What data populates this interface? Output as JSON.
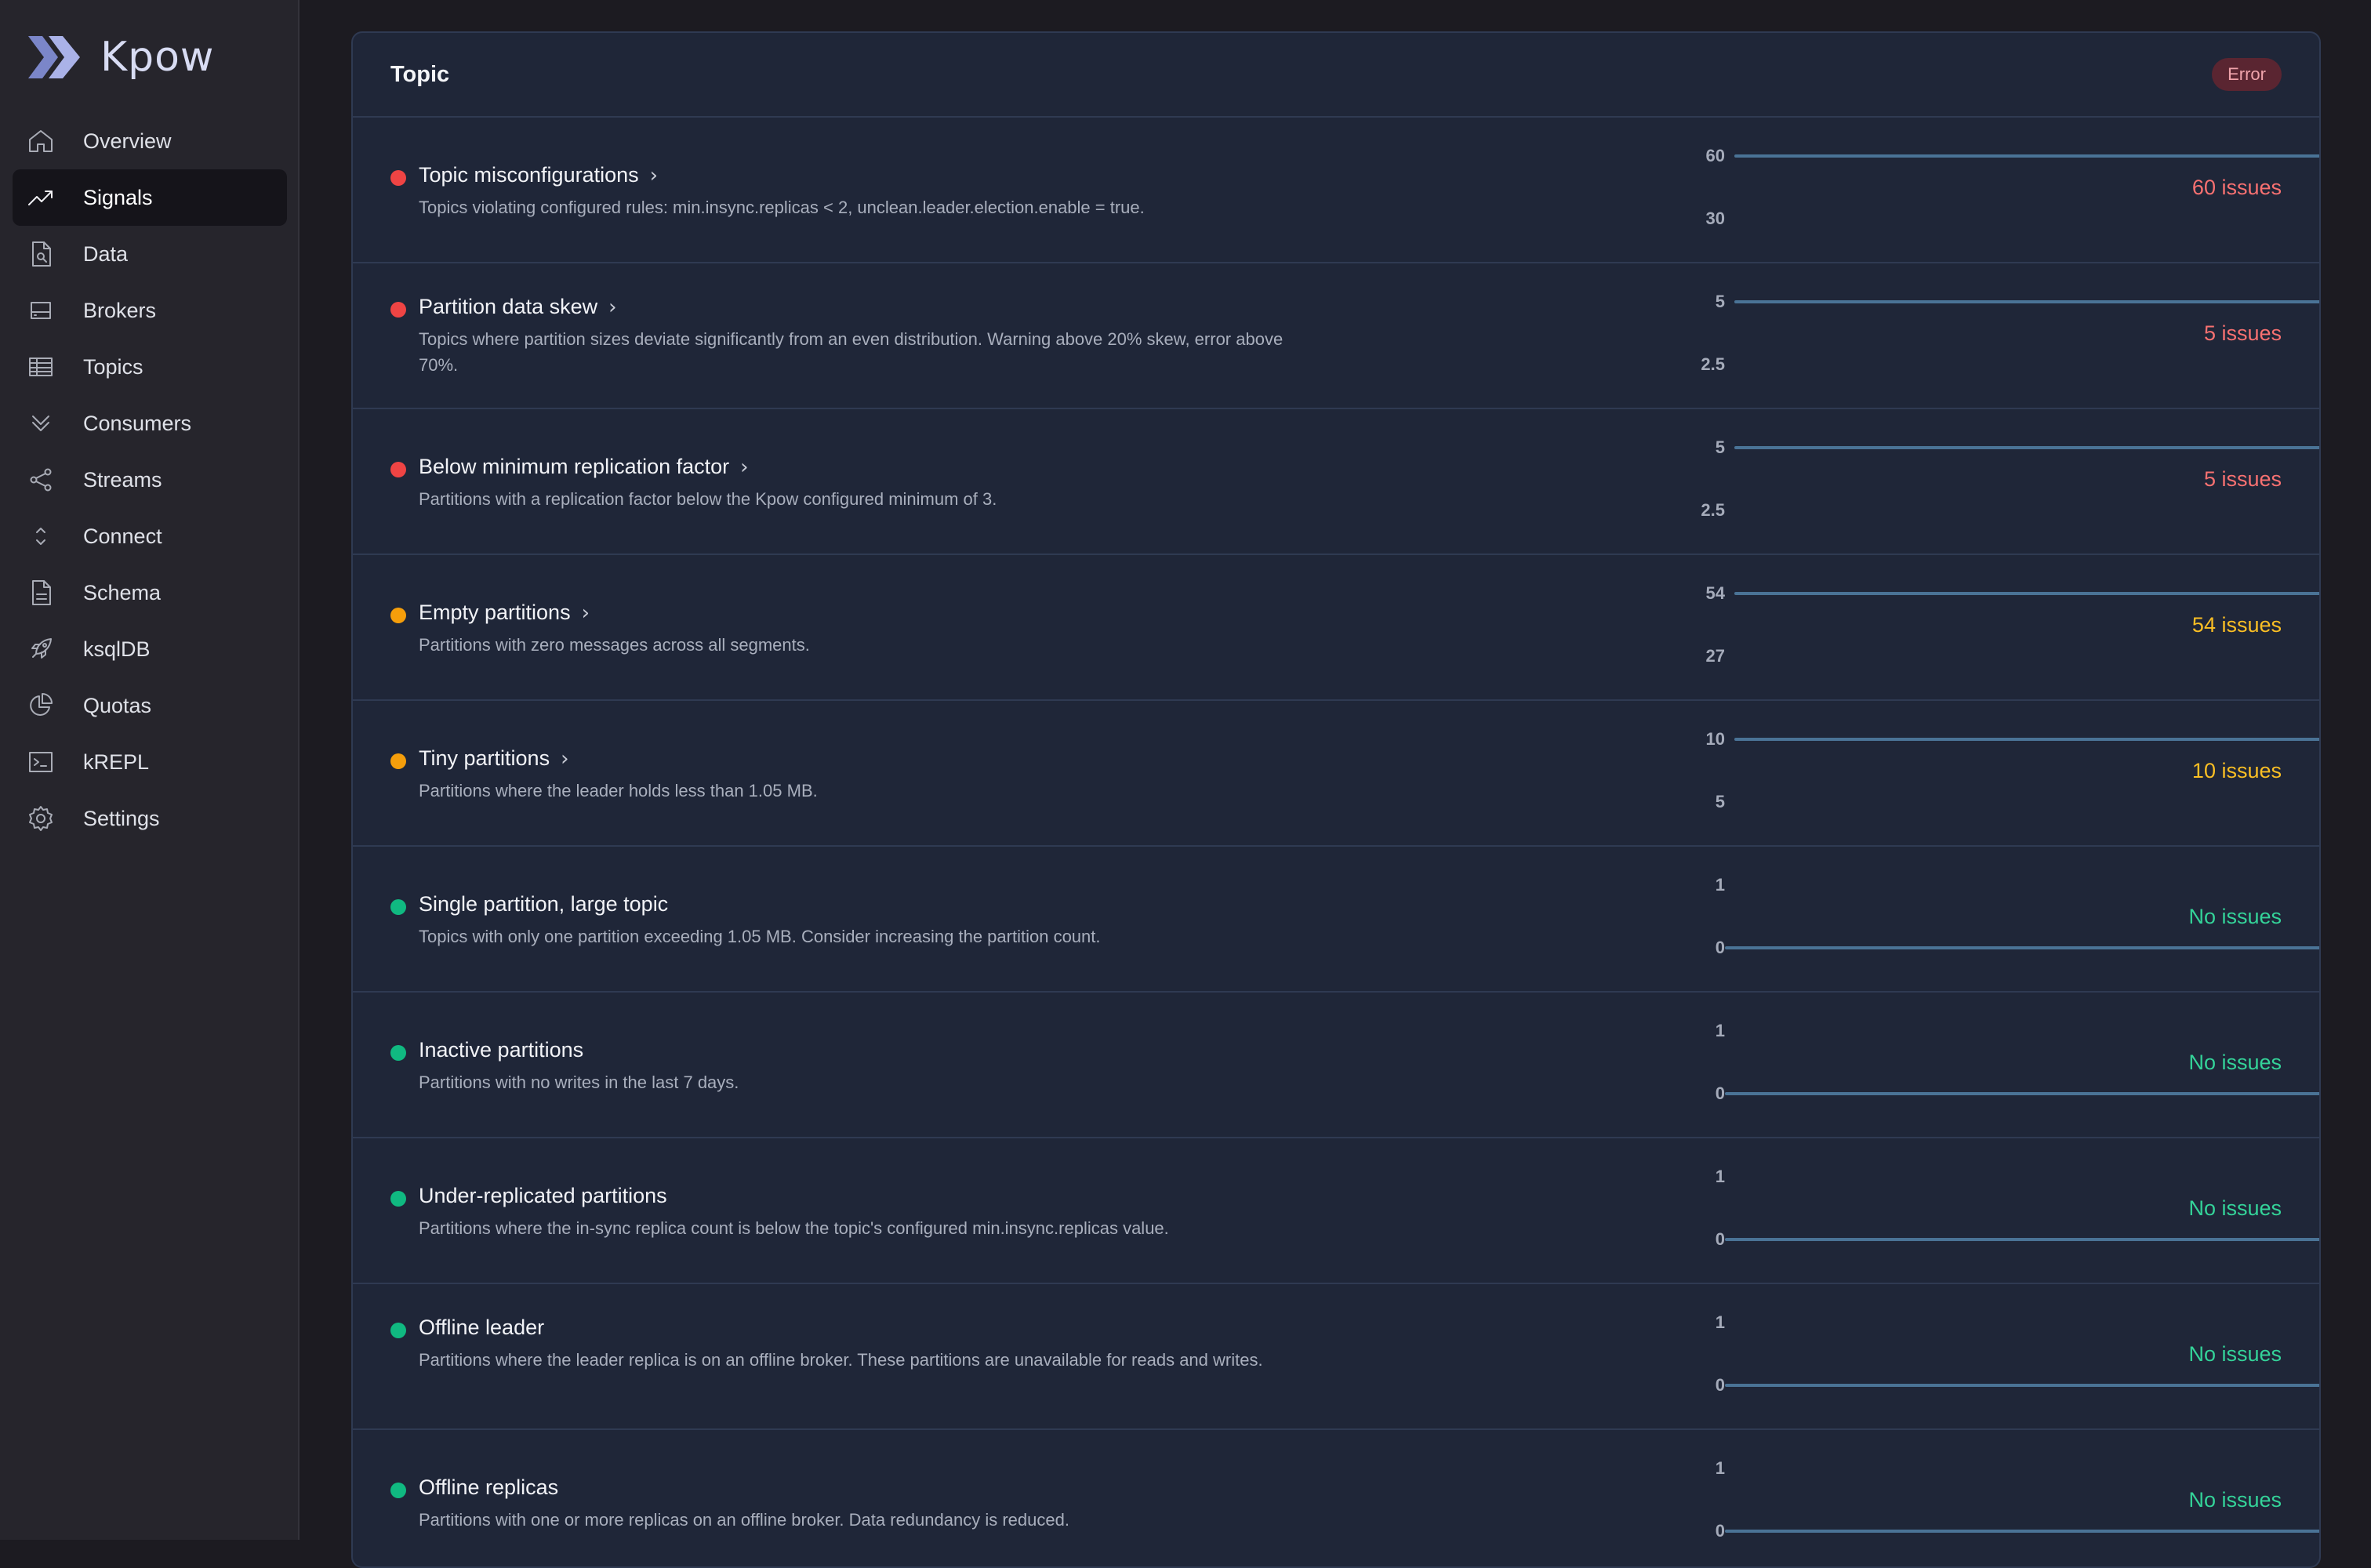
{
  "app": {
    "logo_text": "Kpow"
  },
  "sidebar": {
    "items": [
      {
        "label": "Overview",
        "icon": "home-icon",
        "active": false
      },
      {
        "label": "Signals",
        "icon": "trend-icon",
        "active": true
      },
      {
        "label": "Data",
        "icon": "file-search-icon",
        "active": false
      },
      {
        "label": "Brokers",
        "icon": "server-icon",
        "active": false
      },
      {
        "label": "Topics",
        "icon": "table-icon",
        "active": false
      },
      {
        "label": "Consumers",
        "icon": "double-chevron-down-icon",
        "active": false
      },
      {
        "label": "Streams",
        "icon": "share-icon",
        "active": false
      },
      {
        "label": "Connect",
        "icon": "chevrons-up-down-icon",
        "active": false
      },
      {
        "label": "Schema",
        "icon": "document-icon",
        "active": false
      },
      {
        "label": "ksqlDB",
        "icon": "rocket-icon",
        "active": false
      },
      {
        "label": "Quotas",
        "icon": "pie-chart-icon",
        "active": false
      },
      {
        "label": "kREPL",
        "icon": "terminal-icon",
        "active": false
      },
      {
        "label": "Settings",
        "icon": "gear-icon",
        "active": false
      }
    ]
  },
  "panel": {
    "title": "Topic",
    "badge": "Error",
    "colors": {
      "error": "#ef4444",
      "warning": "#f59e0b",
      "ok": "#10b981",
      "error_text": "#f87171",
      "warning_text": "#fbbf24",
      "ok_text": "#34d399"
    },
    "signals": [
      {
        "title": "Topic misconfigurations",
        "has_link": true,
        "desc": "Topics violating configured rules: min.insync.replicas < 2, unclean.leader.election.enable = true.",
        "severity": "error",
        "y_top": "60",
        "y_bottom": "30",
        "value": 60,
        "status": "60 issues"
      },
      {
        "title": "Partition data skew",
        "has_link": true,
        "desc": "Topics where partition sizes deviate significantly from an even distribution. Warning above 20% skew, error above 70%.",
        "severity": "error",
        "y_top": "5",
        "y_bottom": "2.5",
        "value": 5,
        "status": "5 issues"
      },
      {
        "title": "Below minimum replication factor",
        "has_link": true,
        "desc": "Partitions with a replication factor below the Kpow configured minimum of 3.",
        "severity": "error",
        "y_top": "5",
        "y_bottom": "2.5",
        "value": 5,
        "status": "5 issues"
      },
      {
        "title": "Empty partitions",
        "has_link": true,
        "desc": "Partitions with zero messages across all segments.",
        "severity": "warning",
        "y_top": "54",
        "y_bottom": "27",
        "value": 54,
        "status": "54 issues"
      },
      {
        "title": "Tiny partitions",
        "has_link": true,
        "desc": "Partitions where the leader holds less than 1.05 MB.",
        "severity": "warning",
        "y_top": "10",
        "y_bottom": "5",
        "value": 10,
        "status": "10 issues"
      },
      {
        "title": "Single partition, large topic",
        "has_link": false,
        "desc": "Topics with only one partition exceeding 1.05 MB. Consider increasing the partition count.",
        "severity": "ok",
        "y_top": "1",
        "y_bottom": "0",
        "value": 0,
        "status": "No issues"
      },
      {
        "title": "Inactive partitions",
        "has_link": false,
        "desc": "Partitions with no writes in the last 7 days.",
        "severity": "ok",
        "y_top": "1",
        "y_bottom": "0",
        "value": 0,
        "status": "No issues"
      },
      {
        "title": "Under-replicated partitions",
        "has_link": false,
        "desc": "Partitions where the in-sync replica count is below the topic's configured min.insync.replicas value.",
        "severity": "ok",
        "y_top": "1",
        "y_bottom": "0",
        "value": 0,
        "status": "No issues"
      },
      {
        "title": "Offline leader",
        "has_link": false,
        "desc": "Partitions where the leader replica is on an offline broker. These partitions are unavailable for reads and writes.",
        "severity": "ok",
        "y_top": "1",
        "y_bottom": "0",
        "value": 0,
        "status": "No issues"
      },
      {
        "title": "Offline replicas",
        "has_link": false,
        "desc": "Partitions with one or more replicas on an offline broker. Data redundancy is reduced.",
        "severity": "ok",
        "y_top": "1",
        "y_bottom": "0",
        "value": 0,
        "status": "No issues"
      }
    ]
  }
}
